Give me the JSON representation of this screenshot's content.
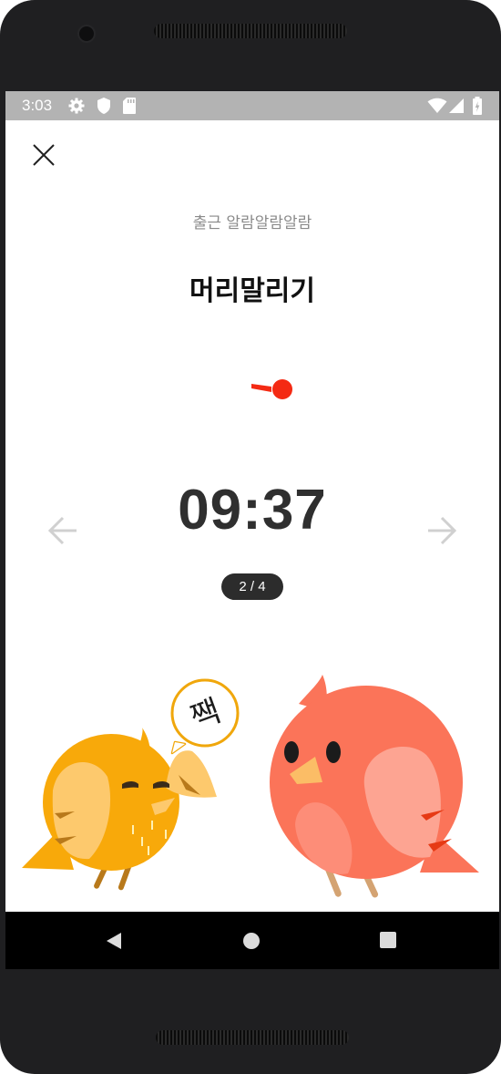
{
  "status_bar": {
    "time": "3:03",
    "icons": [
      "gear-icon",
      "shield-icon",
      "sd-card-icon",
      "wifi-icon",
      "signal-icon",
      "battery-icon"
    ]
  },
  "header": {
    "close_icon": "close-icon"
  },
  "alarm": {
    "name": "출근 알람알람알람",
    "task": "머리말리기",
    "timer": "09:37",
    "progress_label": "2 / 4"
  },
  "speech_bubble": {
    "text": "짹"
  },
  "navigation": {
    "prev_icon": "arrow-left-icon",
    "next_icon": "arrow-right-icon",
    "system": [
      "back-icon",
      "home-icon",
      "recents-icon"
    ]
  },
  "colors": {
    "accent_red": "#f42a13",
    "timer_text": "#2f2f2f",
    "badge_bg": "#2c2c2c",
    "yellow_bird": "#f8a90a",
    "red_bird": "#fb7459"
  }
}
